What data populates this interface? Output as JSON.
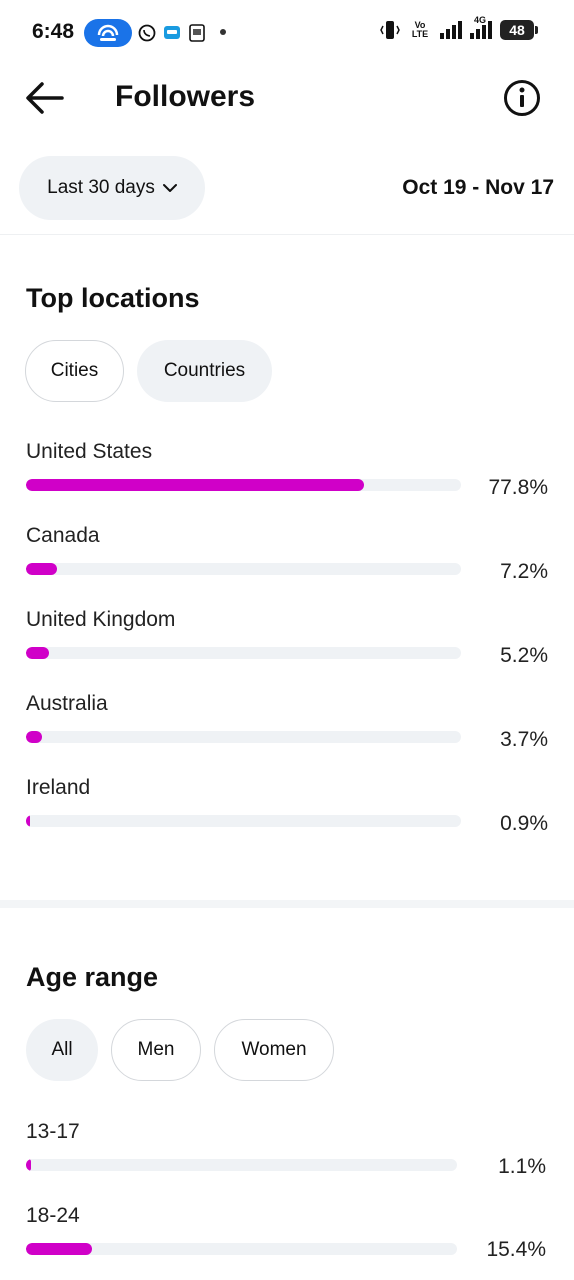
{
  "status_bar": {
    "time": "6:48",
    "network_label": "Vo LTE",
    "network_type": "4G",
    "battery": "48",
    "icons": [
      "hotspot-icon",
      "whatsapp-icon",
      "app-notification-icon",
      "gallery-notification-icon",
      "vibrate-icon",
      "signal-icon",
      "battery-icon"
    ]
  },
  "header": {
    "title": "Followers",
    "back_icon": "arrow-left-icon",
    "info_icon": "info-icon"
  },
  "range": {
    "selected": "Last 30 days",
    "dates": "Oct 19 - Nov 17"
  },
  "top_locations": {
    "title": "Top locations",
    "tabs": [
      "Cities",
      "Countries"
    ],
    "active_tab": "Countries",
    "rows": [
      {
        "label": "United States",
        "percent_text": "77.8%",
        "value": 77.8
      },
      {
        "label": "Canada",
        "percent_text": "7.2%",
        "value": 7.2
      },
      {
        "label": "United Kingdom",
        "percent_text": "5.2%",
        "value": 5.2
      },
      {
        "label": "Australia",
        "percent_text": "3.7%",
        "value": 3.7
      },
      {
        "label": "Ireland",
        "percent_text": "0.9%",
        "value": 0.9
      }
    ]
  },
  "age_range": {
    "title": "Age range",
    "tabs": [
      "All",
      "Men",
      "Women"
    ],
    "active_tab": "All",
    "rows": [
      {
        "label": "13-17",
        "percent_text": "1.1%",
        "value": 1.1
      },
      {
        "label": "18-24",
        "percent_text": "15.4%",
        "value": 15.4
      }
    ]
  },
  "colors": {
    "bar_fill": "#d000c8",
    "bar_track": "#eff2f5",
    "chip_active": "#eff2f5",
    "hotspot": "#1a73e8"
  }
}
